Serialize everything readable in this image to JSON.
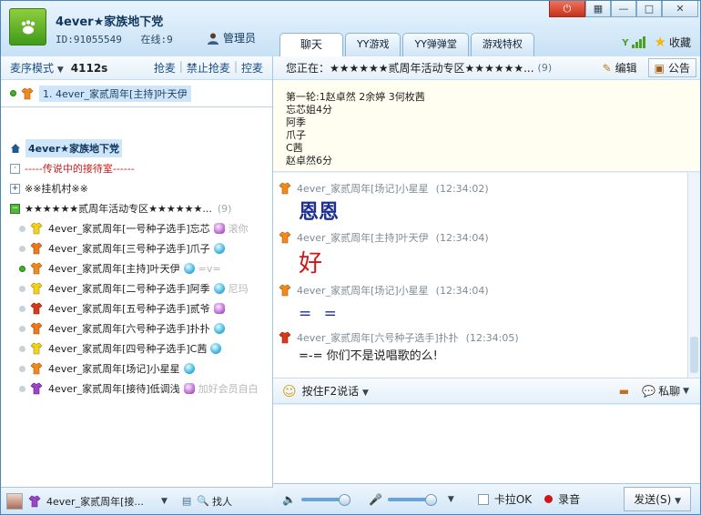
{
  "header": {
    "title": "4ever★家族地下党",
    "id_label": "ID:91055549",
    "online_label": "在线:9",
    "role": "管理员",
    "tabs": [
      "聊天",
      "YY游戏",
      "YY弹弹堂",
      "游戏特权"
    ],
    "favorite": "收藏"
  },
  "left": {
    "mode": "麦序模式",
    "count": "4112s",
    "actions": [
      "抢麦",
      "禁止抢麦",
      "控麦"
    ],
    "host_item": "1. 4ever_家贰周年[主持]叶天伊",
    "root": "4ever★家族地下党",
    "channels": [
      "-----传说中的接待室------",
      "※※挂机村※※",
      "★★★★★★贰周年活动专区★★★★★★..."
    ],
    "channel_count": "(9)",
    "users": [
      {
        "name": "4ever_家贰周年[一号种子选手]忘芯",
        "sign": "滚你"
      },
      {
        "name": "4ever_家贰周年[三号种子选手]爪子",
        "sign": ""
      },
      {
        "name": "4ever_家贰周年[主持]叶天伊",
        "sign": "=v="
      },
      {
        "name": "4ever_家贰周年[二号种子选手]阿季",
        "sign": "尼玛"
      },
      {
        "name": "4ever_家贰周年[五号种子选手]贰爷",
        "sign": ""
      },
      {
        "name": "4ever_家贰周年[六号种子选手]扑扑",
        "sign": ""
      },
      {
        "name": "4ever_家贰周年[四号种子选手]C茜",
        "sign": ""
      },
      {
        "name": "4ever_家贰周年[场记]小星星",
        "sign": ""
      },
      {
        "name": "4ever_家贰周年[接待]低调浅",
        "sign": "加好会员自白"
      }
    ],
    "bottom_user": "4ever_家贰周年[接...",
    "find": "找人"
  },
  "right": {
    "now_label": "您正在：★★★★★★贰周年活动专区★★★★★★...",
    "now_count": "(9)",
    "edit": "编辑",
    "notice_btn": "公告",
    "notice": [
      "第一轮:1赵卓然 2余婷 3何枚茜",
      "忘芯姐4分",
      "阿季",
      "爪子",
      "C茜",
      "赵卓然6分"
    ],
    "messages": [
      {
        "sender": "4ever_家贰周年[场记]小星星",
        "time": "(12:34:02)",
        "text": "恩恩"
      },
      {
        "sender": "4ever_家贰周年[主持]叶天伊",
        "time": "(12:34:04)",
        "text": "好"
      },
      {
        "sender": "4ever_家贰周年[场记]小星星",
        "time": "(12:34:04)",
        "text": "= ="
      },
      {
        "sender": "4ever_家贰周年[六号种子选手]扑扑",
        "time": "(12:34:05)",
        "text": "=-=  你们不是说唱歌的么!"
      }
    ],
    "ptt": "按住F2说话",
    "private_chat": "私聊",
    "karaoke": "卡拉OK",
    "record": "录音",
    "send": "发送(S)"
  }
}
